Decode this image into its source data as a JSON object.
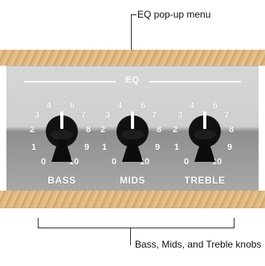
{
  "callouts": {
    "eq_popup": "EQ pop-up menu",
    "knobs": "Bass, Mids, and Treble knobs"
  },
  "panel": {
    "eq_label": "EQ"
  },
  "knobs": [
    {
      "label": "BASS",
      "ticks": [
        "0",
        "1",
        "2",
        "3",
        "4",
        "6",
        "7",
        "8",
        "9",
        "10"
      ]
    },
    {
      "label": "MIDS",
      "ticks": [
        "0",
        "1",
        "2",
        "3",
        "4",
        "6",
        "7",
        "8",
        "9",
        "10"
      ]
    },
    {
      "label": "TREBLE",
      "ticks": [
        "0",
        "1",
        "2",
        "3",
        "4",
        "6",
        "7",
        "8",
        "9",
        "10"
      ]
    }
  ],
  "colors": {
    "knob": "#111111",
    "panel_text": "#ffffff",
    "wood": "#dcb57e"
  }
}
